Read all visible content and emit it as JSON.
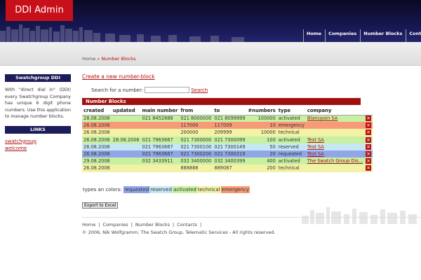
{
  "header": {
    "logo": "DDI Admin",
    "nav": [
      "Home",
      "Companies",
      "Number Blocks",
      "Contacts"
    ]
  },
  "breadcrumb": {
    "home": "Home",
    "separator": " » ",
    "current": "Number Blocks"
  },
  "sidebar": {
    "title": "Swatchgroup DDI",
    "text": "With \"direct dial in\" (DDI) every Swatchgroup Company has unique 6 digit phone numbers. Use this application to manage number blocks.",
    "links_title": "LINKS",
    "links": [
      "swatchgroup",
      "welcome"
    ]
  },
  "main": {
    "create_link": "Create a new number-block",
    "search_label": "Search for a number:",
    "search_value": "",
    "search_button": "Search",
    "table_title": "Number Blocks",
    "columns": [
      "created",
      "updated",
      "main number",
      "from",
      "to",
      "#numbers",
      "type",
      "company",
      ""
    ],
    "rows": [
      {
        "created": "28.08.2006",
        "updated": "",
        "main": "021 8452888",
        "from": "021 8000000",
        "to": "021 8099999",
        "count": "100000",
        "type": "activated",
        "company": "Blancpain SA"
      },
      {
        "created": "26.08.2006",
        "updated": "",
        "main": "",
        "from": "117000",
        "to": "117009",
        "count": "10",
        "type": "emergency",
        "company": ""
      },
      {
        "created": "26.08.2006",
        "updated": "",
        "main": "",
        "from": "200000",
        "to": "209999",
        "count": "10000",
        "type": "technical",
        "company": ""
      },
      {
        "created": "26.08.2006",
        "updated": "28.08.2006",
        "main": "021 7963667",
        "from": "021 7300000",
        "to": "021 7300099",
        "count": "100",
        "type": "activated",
        "company": "Test SA"
      },
      {
        "created": "26.08.2006",
        "updated": "",
        "main": "021 7963667",
        "from": "021 7300100",
        "to": "021 7300149",
        "count": "50",
        "type": "reserved",
        "company": "Test SA"
      },
      {
        "created": "26.08.2006",
        "updated": "",
        "main": "021 7963667",
        "from": "021 7300200",
        "to": "021 7300219",
        "count": "20",
        "type": "requested",
        "company": "Test SA"
      },
      {
        "created": "29.08.2006",
        "updated": "",
        "main": "032 3433911",
        "from": "032 3400000",
        "to": "032 3400399",
        "count": "400",
        "type": "activated",
        "company": "The Swatch Group Dis..."
      },
      {
        "created": "26.08.2006",
        "updated": "",
        "main": "",
        "from": "888888",
        "to": "889087",
        "count": "200",
        "type": "technical",
        "company": ""
      }
    ],
    "legend_label": "types an colors:",
    "legend": [
      "requested",
      "reserved",
      "activated",
      "technical",
      "emergency"
    ],
    "export_button": "Export to Excel"
  },
  "footer": {
    "links": [
      "Home",
      "|",
      "Companies",
      "|",
      "Number Blocks",
      "|",
      "Contacts",
      "|"
    ],
    "copyright": "© 2006, Nik Wolfgramm, The Swatch Group, Telematic Services - All rights reserved."
  },
  "colors": {
    "header": "#161650",
    "logo": "#c8101a",
    "table_title": "#a01010",
    "requested": "#8fa6e8",
    "reserved": "#c6e8f4",
    "activated": "#c8f0a0",
    "technical": "#f2f2a6",
    "emergency": "#f79a78"
  },
  "icons": {
    "delete": "delete-icon"
  }
}
